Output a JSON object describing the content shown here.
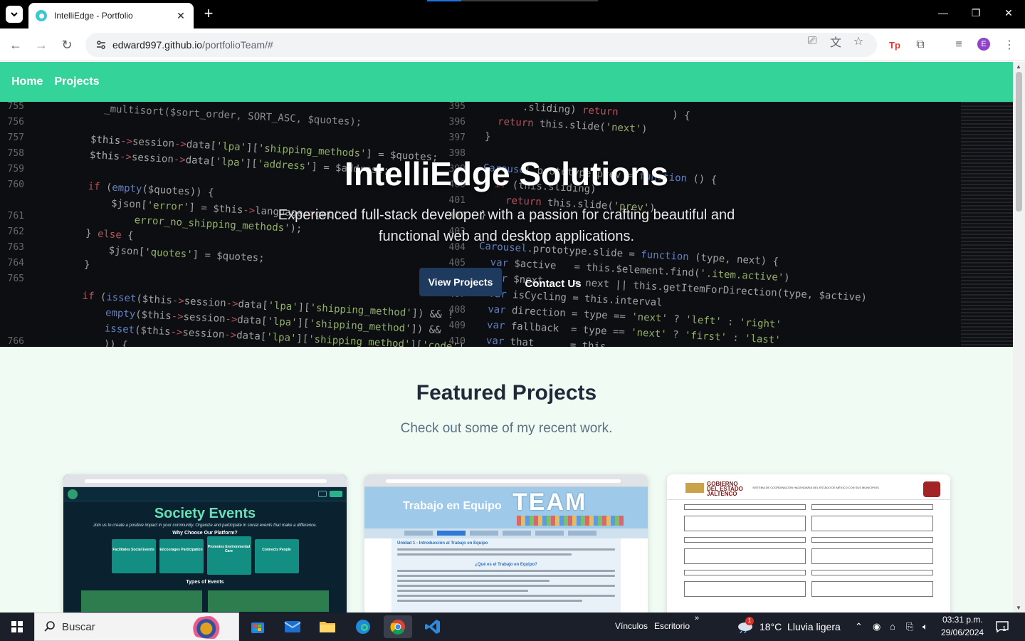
{
  "browser": {
    "tab_title": "IntelliEdge - Portfolio",
    "url_host": "edward997.github.io",
    "url_path": "/portfolioTeam/#",
    "profile_initial": "E"
  },
  "site": {
    "nav": [
      "Home",
      "Projects"
    ],
    "hero": {
      "title": "IntelliEdge Solutions",
      "subtitle": "Experienced full-stack developer with a passion for crafting beautiful and functional web and desktop applications.",
      "primary_button": "View Projects",
      "secondary_button": "Contact Us"
    },
    "featured": {
      "title": "Featured Projects",
      "subtitle": "Check out some of my recent work."
    },
    "projects": [
      {
        "heading": "Society Events",
        "tagline": "Join us to create a positive impact in your community. Organize and participate in social events that make a difference.",
        "why": "Why Choose Our Platform?",
        "features": [
          "Facilitates Social Events",
          "Encourages Participation",
          "Promotes Environmental Care",
          "Connects People"
        ],
        "types": "Types of Events"
      },
      {
        "banner_title": "Trabajo en Equipo",
        "banner_word": "TEAM",
        "section_title": "Unidad 1 - Introducción al Trabajo en Equipo",
        "question": "¿Qué es el Trabajo en Equipo?"
      },
      {
        "logo_text_1": "GOBIERNO",
        "logo_text_2": "DEL ESTADO",
        "logo_text_3": "JALTENCO",
        "header_text": "SISTEMA DE COORDINACIÓN HACENDARIA DEL ESTADO DE MÉXICO CON SUS MUNICIPIOS"
      }
    ]
  },
  "taskbar": {
    "search_placeholder": "Buscar",
    "links": "Vínculos",
    "desktop": "Escritorio",
    "weather": "18°C  Lluvia ligera",
    "time": "03:31 p.m.",
    "date": "29/06/2024",
    "notif_count": "1"
  }
}
